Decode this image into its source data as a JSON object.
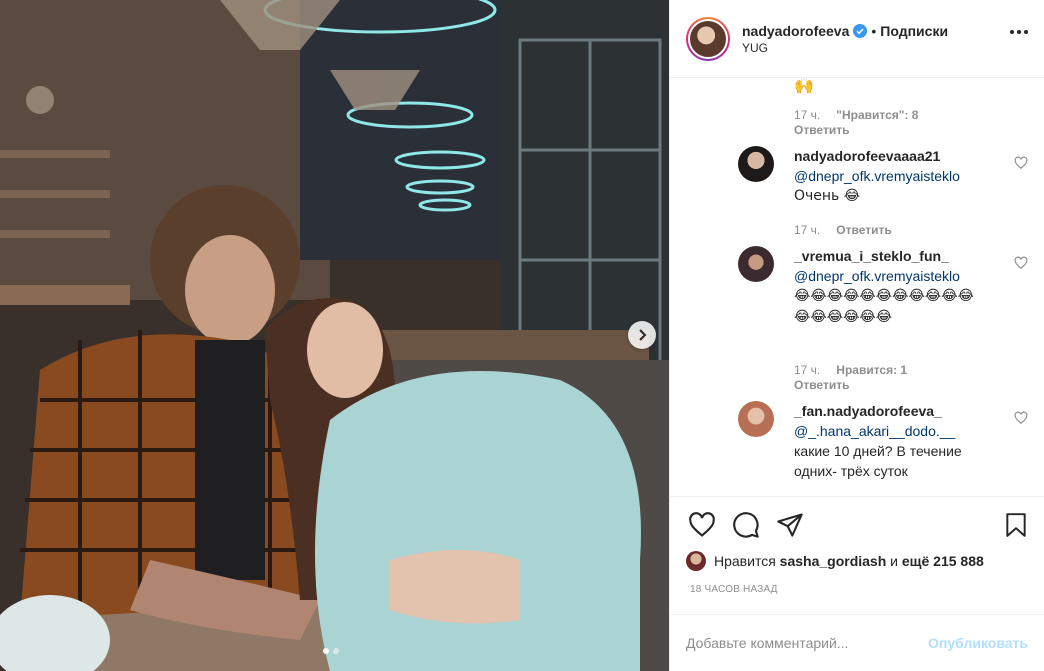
{
  "header": {
    "username": "nadyadorofeeva",
    "separator": "•",
    "follow_label": "Подписки",
    "location": "YUG"
  },
  "comments": {
    "top_emoji": "🙌",
    "top_meta": {
      "time": "17 ч.",
      "likes": "\"Нравится\": 8",
      "reply": "Ответить"
    },
    "items": [
      {
        "username": "nadyadorofeevaaaa21",
        "mention": "@dnepr_ofk.vremyaisteklo",
        "text": "Очень 😂",
        "time": "17 ч.",
        "likes": "",
        "reply": "Ответить"
      },
      {
        "username": "_vremua_i_steklo_fun_",
        "mention": "@dnepr_ofk.vremyaisteklo",
        "text": "😂😂😂😂😂😂😂😂😂😂😂😂😂😂😂😂😂",
        "time": "17 ч.",
        "likes": "Нравится: 1",
        "reply": "Ответить"
      },
      {
        "username": "_fan.nadyadorofeeva_",
        "mention": "@_.hana_akari__dodo.__",
        "text": "какие 10 дней? В течение одних- трёх суток",
        "time": "",
        "likes": "",
        "reply": ""
      }
    ]
  },
  "likes": {
    "prefix": "Нравится",
    "user": "sasha_gordiash",
    "middle": "и",
    "count": "ещё 215 888"
  },
  "time_ago": "18 часов назад",
  "add_comment": {
    "placeholder": "Добавьте комментарий...",
    "publish_label": "Опубликовать"
  },
  "colors": {
    "verified": "#3897f0",
    "mention": "#00376b",
    "publish_disabled": "#b2dffc",
    "meta_gray": "#8e8e8e"
  }
}
